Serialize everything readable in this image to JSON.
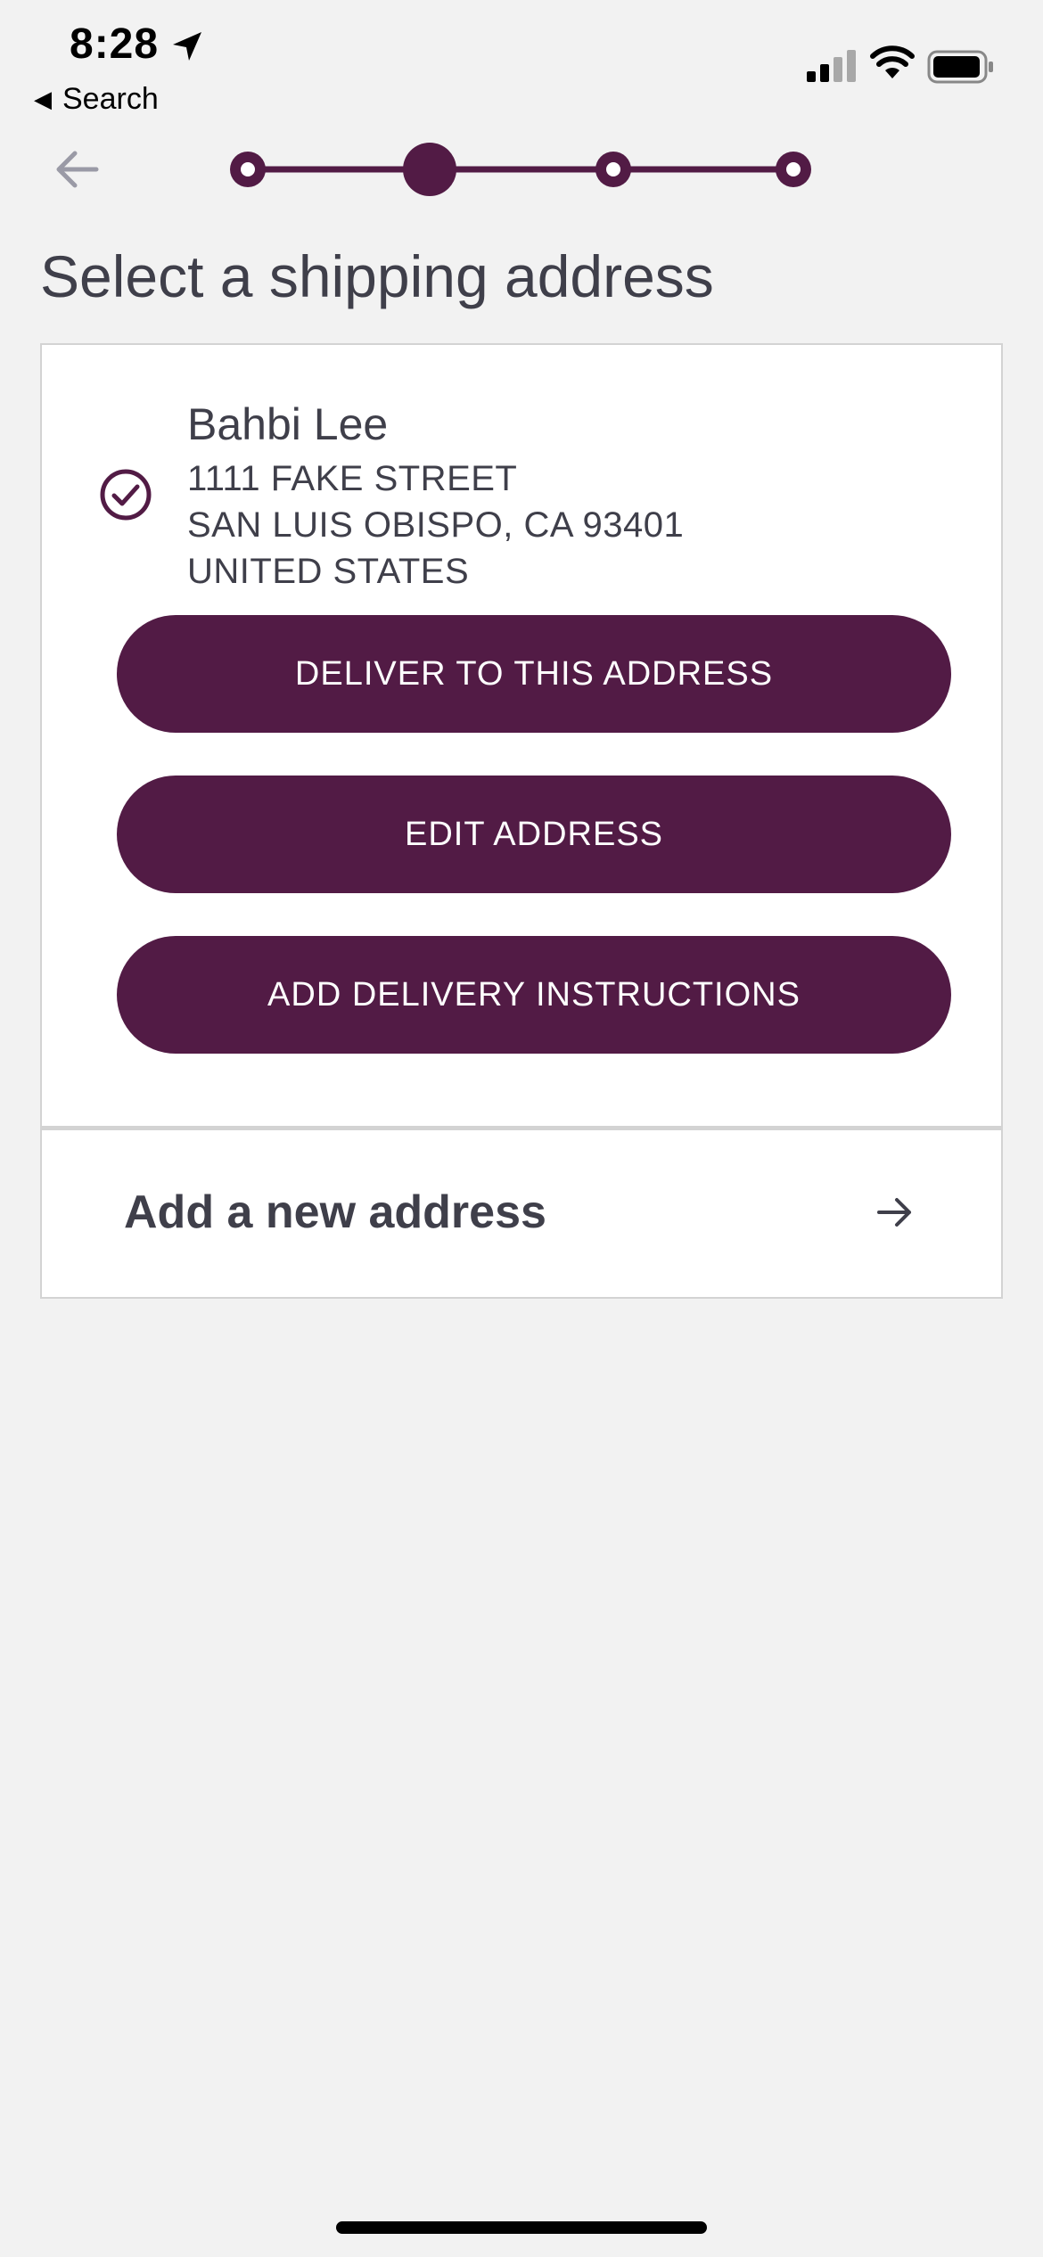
{
  "status_bar": {
    "time": "8:28",
    "back_app": "Search"
  },
  "nav": {
    "back_icon": "arrow-left-icon",
    "stepper": {
      "total_steps": 4,
      "current_step": 2
    }
  },
  "page": {
    "title": "Select a shipping address"
  },
  "address": {
    "selected": true,
    "name": "Bahbi Lee",
    "line1": "1111 FAKE STREET",
    "line2": "SAN LUIS OBISPO, CA 93401",
    "line3": "UNITED STATES"
  },
  "actions": {
    "deliver": "DELIVER TO THIS ADDRESS",
    "edit": "EDIT ADDRESS",
    "instructions": "ADD DELIVERY INSTRUCTIONS"
  },
  "new_address": {
    "label": "Add a new address"
  },
  "colors": {
    "accent": "#521b45",
    "background": "#f2f2f2",
    "text": "#3f3f4a"
  }
}
